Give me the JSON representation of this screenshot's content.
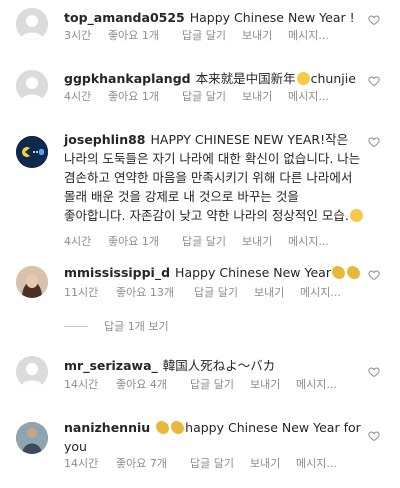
{
  "comments": [
    {
      "username": "top_amanda0525",
      "text": "Happy Chinese New Year !",
      "time": "3시간",
      "likes": "좋아요 1개",
      "reply": "답글 달기",
      "send": "보내기",
      "message": "메시지..."
    },
    {
      "username": "ggpkhankaplangd",
      "text": "本来就是中国新年",
      "text_after": "chunjie",
      "time": "4시간",
      "likes": "좋아요 1개",
      "reply": "답글 달기",
      "send": "보내기",
      "message": "메시지..."
    },
    {
      "username": "josephlin88",
      "text": "HAPPY CHINESE NEW YEAR!작은 나라의 도둑들은 자기 나라에 대한 확신이 없습니다. 나는 겸손하고 연약한 마음을 만족시키기 위해 다른 나라에서 몰래 배운 것을 강제로 내 것으로 바꾸는 것을 좋아합니다. 자존감이 낮고 약한 나라의 정상적인 모습.",
      "time": "4시간",
      "likes": "좋아요 1개",
      "reply": "답글 달기",
      "send": "보내기",
      "message": "메시지..."
    },
    {
      "username": "mmississippi_d",
      "text": "Happy Chinese New Year",
      "time": "11시간",
      "likes": "좋아요 13개",
      "reply": "답글 달기",
      "send": "보내기",
      "message": "메시지..."
    },
    {
      "username": "mr_serizawa_",
      "text": "韓国人死ねよ～バカ",
      "time": "14시간",
      "likes": "좋아요 4개",
      "reply": "답글 달기",
      "send": "보내기",
      "message": "메시지..."
    },
    {
      "username": "nanizhenniu",
      "text": "happy Chinese  New Year  for you",
      "time": "14시간",
      "likes": "좋아요 7개",
      "reply": "답글 달기",
      "send": "보내기",
      "message": "메시지..."
    }
  ],
  "view_replies": "답글 1개 보기",
  "icons": {
    "like": "heart-icon",
    "clap": "clapping-hands-emoji",
    "sad": "sad-face-emoji",
    "wow": "astonished-face-emoji"
  },
  "colors": {
    "text": "#262626",
    "meta": "#8e8e8e",
    "avatar_placeholder": "#dbdbdb"
  }
}
